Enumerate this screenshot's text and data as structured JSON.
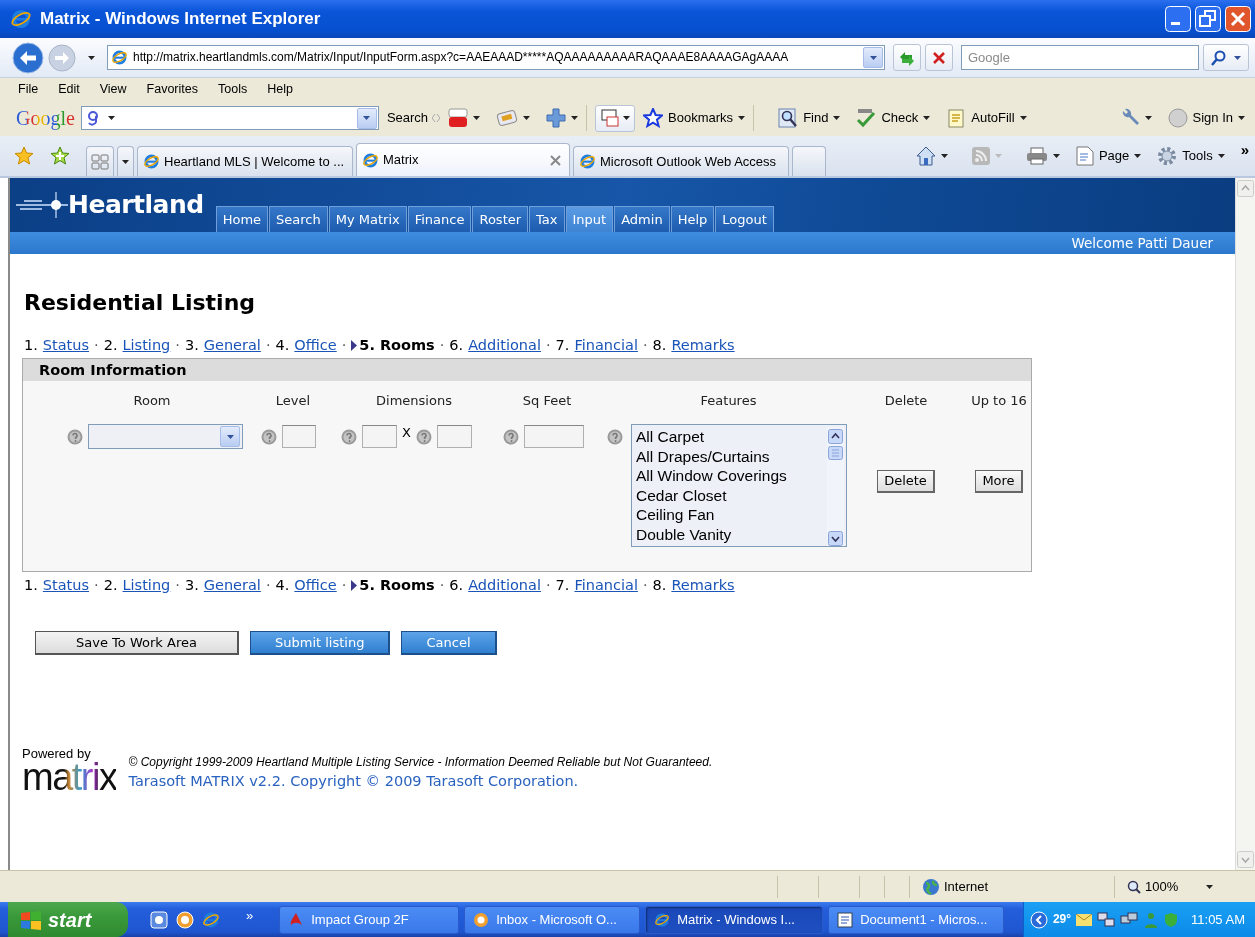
{
  "window": {
    "title": "Matrix - Windows Internet Explorer"
  },
  "address_bar": {
    "url": "http://matrix.heartlandmls.com/Matrix/Input/InputForm.aspx?c=AAEAAAD*****AQAAAAAAAAARAQAAAE8AAAAGAgAAAA"
  },
  "search_box": {
    "placeholder": "Google"
  },
  "menu_bar": [
    "File",
    "Edit",
    "View",
    "Favorites",
    "Tools",
    "Help"
  ],
  "google_toolbar": {
    "logo": "Google",
    "search_label": "Search",
    "items": [
      "Bookmarks",
      "Find",
      "Check",
      "AutoFill"
    ],
    "sign_in": "Sign In"
  },
  "tabs": [
    {
      "label": "Heartland MLS | Welcome to ...",
      "selected": false
    },
    {
      "label": "Matrix",
      "selected": true
    },
    {
      "label": "Microsoft Outlook Web Access",
      "selected": false
    }
  ],
  "command_bar": {
    "items": [
      "Page",
      "Tools"
    ],
    "overflow": "»"
  },
  "site": {
    "logo": "Heartland",
    "nav": [
      {
        "label": "Home",
        "selected": false
      },
      {
        "label": "Search",
        "selected": false
      },
      {
        "label": "My Matrix",
        "selected": false
      },
      {
        "label": "Finance",
        "selected": false
      },
      {
        "label": "Roster",
        "selected": false
      },
      {
        "label": "Tax",
        "selected": false
      },
      {
        "label": "Input",
        "selected": true
      },
      {
        "label": "Admin",
        "selected": false
      },
      {
        "label": "Help",
        "selected": false
      },
      {
        "label": "Logout",
        "selected": false
      }
    ],
    "welcome": "Welcome Patti Dauer"
  },
  "page_title": "Residential Listing",
  "steps_top": [
    {
      "number": "1.",
      "label": "Status",
      "current": false,
      "separator_after": "·"
    },
    {
      "number": "2.",
      "label": "Listing",
      "current": false,
      "separator_after": "·"
    },
    {
      "number": "3.",
      "label": "General",
      "current": false,
      "separator_after": "·"
    },
    {
      "number": "4.",
      "label": "Office",
      "current": false,
      "separator_after": "·"
    },
    {
      "number": "5.",
      "label": "Rooms",
      "current": true,
      "separator_after": "·"
    },
    {
      "number": "6.",
      "label": "Additional",
      "current": false,
      "separator_after": "·"
    },
    {
      "number": "7.",
      "label": "Financial",
      "current": false,
      "separator_after": "·"
    },
    {
      "number": "8.",
      "label": "Remarks",
      "current": false
    }
  ],
  "room_information": {
    "title": "Room Information",
    "columns": [
      "Room",
      "Level",
      "Dimensions",
      "Sq Feet",
      "Features",
      "Delete",
      "Up to 16"
    ],
    "dimension_separator": "X",
    "features": [
      "All Carpet",
      "All Drapes/Curtains",
      "All Window Coverings",
      "Cedar Closet",
      "Ceiling Fan",
      "Double Vanity"
    ],
    "delete_button": "Delete",
    "more_button": "More"
  },
  "steps_bottom": [
    {
      "number": "1.",
      "label": "Status",
      "current": false,
      "separator_after": "·"
    },
    {
      "number": "2.",
      "label": "Listing",
      "current": false,
      "separator_after": "·"
    },
    {
      "number": "3.",
      "label": "General",
      "current": false,
      "separator_after": "·"
    },
    {
      "number": "4.",
      "label": "Office",
      "current": false,
      "separator_after": "·"
    },
    {
      "number": "5.",
      "label": "Rooms",
      "current": true,
      "separator_after": "·"
    },
    {
      "number": "6.",
      "label": "Additional",
      "current": false,
      "separator_after": "·"
    },
    {
      "number": "7.",
      "label": "Financial",
      "current": false,
      "separator_after": "·"
    },
    {
      "number": "8.",
      "label": "Remarks",
      "current": false
    }
  ],
  "actions": [
    {
      "label": "Save To Work Area",
      "kind": "default"
    },
    {
      "label": "Submit listing",
      "kind": "primary"
    },
    {
      "label": "Cancel",
      "kind": "primary"
    }
  ],
  "footer": {
    "powered_by": "Powered by",
    "logo": "matrix",
    "copyright": "© Copyright 1999-2009 Heartland Multiple Listing Service - Information Deemed Reliable but Not Guaranteed.",
    "version": "Tarasoft MATRIX v2.2. Copyright © 2009 Tarasoft Corporation."
  },
  "status_bar": {
    "zone": "Internet",
    "zoom": "100%"
  },
  "taskbar": {
    "start": "start",
    "overflow": "»",
    "tasks": [
      {
        "label": "Impact Group 2F",
        "selected": false
      },
      {
        "label": "Inbox - Microsoft O...",
        "selected": false
      },
      {
        "label": "Matrix - Windows I...",
        "selected": true
      },
      {
        "label": "Document1 - Micros...",
        "selected": false
      }
    ],
    "temperature": "29°",
    "clock": "11:05 AM"
  }
}
